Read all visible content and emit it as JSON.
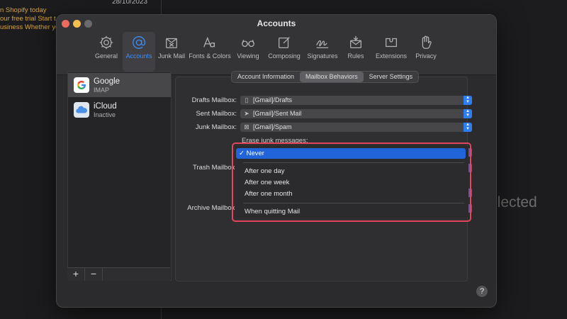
{
  "background": {
    "date": "28/10/2023",
    "preview_lines": [
      "n Shopify today",
      "our free trial Start t",
      "usiness Whether yo"
    ],
    "selected_text": "elected"
  },
  "window": {
    "title": "Accounts",
    "toolbar": [
      {
        "label": "General",
        "icon": "gear-icon"
      },
      {
        "label": "Accounts",
        "icon": "at-icon",
        "active": true
      },
      {
        "label": "Junk Mail",
        "icon": "junk-mail-icon"
      },
      {
        "label": "Fonts & Colors",
        "icon": "fonts-icon"
      },
      {
        "label": "Viewing",
        "icon": "glasses-icon"
      },
      {
        "label": "Composing",
        "icon": "compose-icon"
      },
      {
        "label": "Signatures",
        "icon": "signature-icon"
      },
      {
        "label": "Rules",
        "icon": "rules-icon"
      },
      {
        "label": "Extensions",
        "icon": "extensions-icon"
      },
      {
        "label": "Privacy",
        "icon": "hand-icon"
      }
    ]
  },
  "sidebar": {
    "accounts": [
      {
        "name": "Google",
        "sub": "IMAP",
        "icon": "google-icon",
        "selected": true
      },
      {
        "name": "iCloud",
        "sub": "Inactive",
        "icon": "icloud-icon"
      }
    ],
    "add_label": "+",
    "remove_label": "−"
  },
  "tabs": [
    {
      "label": "Account Information"
    },
    {
      "label": "Mailbox Behaviors",
      "active": true
    },
    {
      "label": "Server Settings"
    }
  ],
  "form": {
    "drafts_label": "Drafts Mailbox:",
    "drafts_value": "[Gmail]/Drafts",
    "sent_label": "Sent Mailbox:",
    "sent_value": "[Gmail]/Sent Mail",
    "junk_label": "Junk Mailbox:",
    "junk_value": "[Gmail]/Spam",
    "erase_label": "Erase junk messages:",
    "trash_label": "Trash Mailbox:",
    "archive_label": "Archive Mailbox:"
  },
  "menu": {
    "items": [
      "Never",
      "After one day",
      "After one week",
      "After one month",
      "When quitting Mail"
    ],
    "selected": "Never",
    "checkmark": "✓"
  },
  "help_label": "?",
  "colors": {
    "accent": "#2163d8",
    "highlight_border": "#e0445e"
  }
}
